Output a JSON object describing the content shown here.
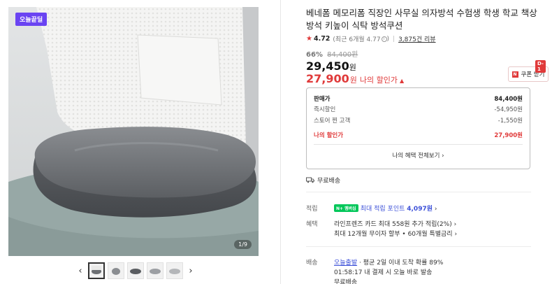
{
  "gallery": {
    "promo_badge": "오늘끝딜",
    "counter": "1/9",
    "prev_arrow": "‹",
    "next_arrow": "›",
    "thumbnail_count": 5
  },
  "product": {
    "title": "베네폼 메모리폼 직장인 사무실 의자방석 수험생 학생 학교 책상 방석 키높이 식탁 방석쿠션",
    "rating": "4.72",
    "rating_detail": "(최근 6개월 4.77",
    "rating_detail_tail": ")",
    "reviews": "3,875건 리뷰",
    "discount_pct": "66%",
    "original_price": "84,400원",
    "price": "29,450",
    "price_unit": "원",
    "my_price": "27,900",
    "my_price_unit": "원",
    "my_price_label": "나의 할인가",
    "coupon_label": "쿠폰 받기",
    "coupon_badge": "D-1"
  },
  "breakdown": {
    "rows": [
      {
        "label": "판매가",
        "value": "84,400원"
      },
      {
        "label": "즉시할인",
        "value": "-54,950원"
      },
      {
        "label": "스토어 찐 고객",
        "value": "-1,550원"
      }
    ],
    "mine_label": "나의 할인가",
    "mine_value": "27,900원",
    "link": "나의 혜택 전체보기 ›"
  },
  "free_shipping": "무료배송",
  "benefits": {
    "points_label": "적립",
    "np_badge": "N+ 멤버십",
    "points_pre": "최대 적립 포인트 ",
    "points_value": "4,097원",
    "points_suffix": " ›",
    "perk_label": "혜택",
    "perk_line1": "라인프렌즈 카드 최대 558원 추가 적립(2%) ›",
    "perk_line2": "최대 12개월 무이자 할부 • 60개월 특별금리 ›"
  },
  "delivery": {
    "label": "배송",
    "today": "오늘출발",
    "line1_rest": " · 평균 2일 이내 도착 확률 89%",
    "line2": "01:58:17  내 결제 시 오늘 바로 발송",
    "line3": "무료배송"
  },
  "colors": {
    "accent_red": "#e03a3a",
    "promo_purple": "#6a44f2",
    "link_blue": "#3b4fd8",
    "membership_green": "#03c75a"
  }
}
